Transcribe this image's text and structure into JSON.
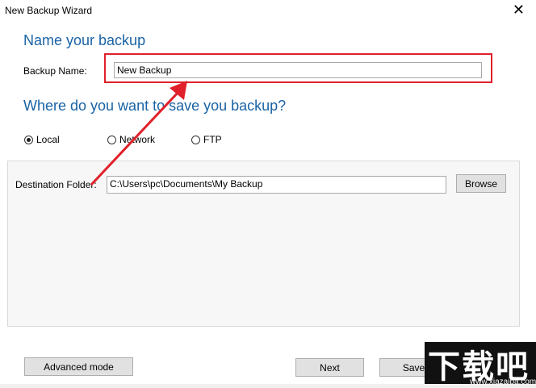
{
  "window": {
    "title": "New Backup Wizard",
    "close_glyph": "✕"
  },
  "name_section": {
    "heading": "Name your backup",
    "backup_name_label": "Backup Name:",
    "backup_name_value": "New Backup"
  },
  "location_section": {
    "heading": "Where do you want to save you backup?",
    "options": [
      {
        "label": "Local",
        "selected": true
      },
      {
        "label": "Network",
        "selected": false
      },
      {
        "label": "FTP",
        "selected": false
      }
    ]
  },
  "destination": {
    "label": "Destination Folder:",
    "path": "C:\\Users\\pc\\Documents\\My Backup",
    "browse_label": "Browse"
  },
  "footer": {
    "advanced_label": "Advanced mode",
    "next_label": "Next",
    "save_label": "Save"
  },
  "watermark": {
    "big": "下载吧",
    "small": "www.xiazaiba.com"
  },
  "colors": {
    "heading": "#1a63a5",
    "highlight": "#e0202a"
  }
}
